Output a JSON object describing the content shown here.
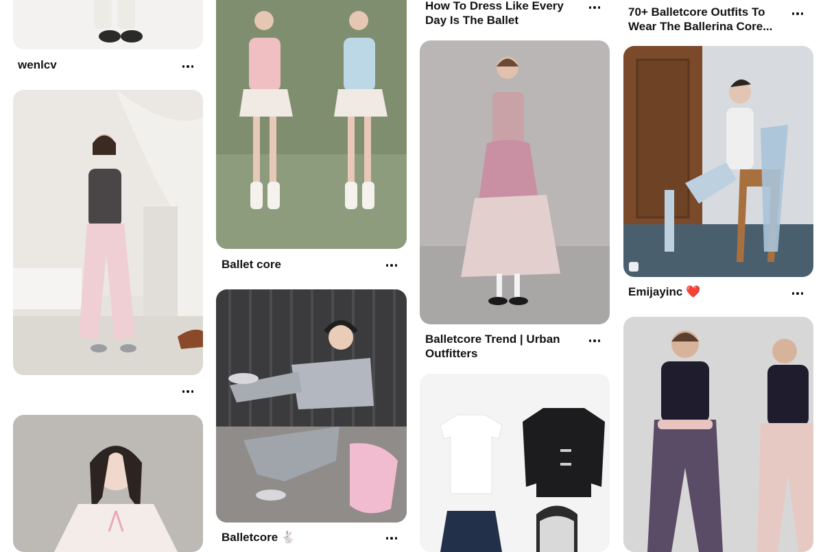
{
  "pins": {
    "col1": {
      "pin1": {
        "title": "wenlcv",
        "image_alt": "model-in-white-leg-warmers-and-black-shoes"
      },
      "pin2": {
        "title": "",
        "image_alt": "model-in-dark-top-and-pink-parachute-pants"
      },
      "pin3": {
        "title": "",
        "image_alt": "model-in-pink-ribbon-top"
      }
    },
    "col2": {
      "pin1": {
        "title": "Ballet core",
        "image_alt": "two-models-in-pink-and-blue-ballet-outfits"
      },
      "pin2": {
        "title": "Balletcore 🐇",
        "image_alt": "model-with-headphones-grey-cardigan-pink-bag"
      }
    },
    "col3": {
      "pin1": {
        "title": "How To Dress Like Every Day Is The Ballet",
        "image_alt": ""
      },
      "pin2": {
        "title": "Balletcore Trend | Urban Outfitters",
        "image_alt": "model-in-pink-tulle-skirt"
      },
      "pin3": {
        "title": "",
        "image_alt": "flat-lay-white-tee-black-jacket-denim-skirt-bag"
      }
    },
    "col4": {
      "pin1": {
        "title": "70+ Balletcore Outfits To Wear The Ballerina Core...",
        "image_alt": ""
      },
      "pin2": {
        "title": "Emijayinc ❤️",
        "image_alt": "model-on-wooden-chair-with-blue-ribbon"
      },
      "pin3": {
        "title": "",
        "image_alt": "dancers-in-navy-tops-and-parachute-pants"
      }
    }
  },
  "colors": {
    "text": "#111111",
    "background": "#ffffff",
    "placeholder": "#e9e9e9"
  }
}
